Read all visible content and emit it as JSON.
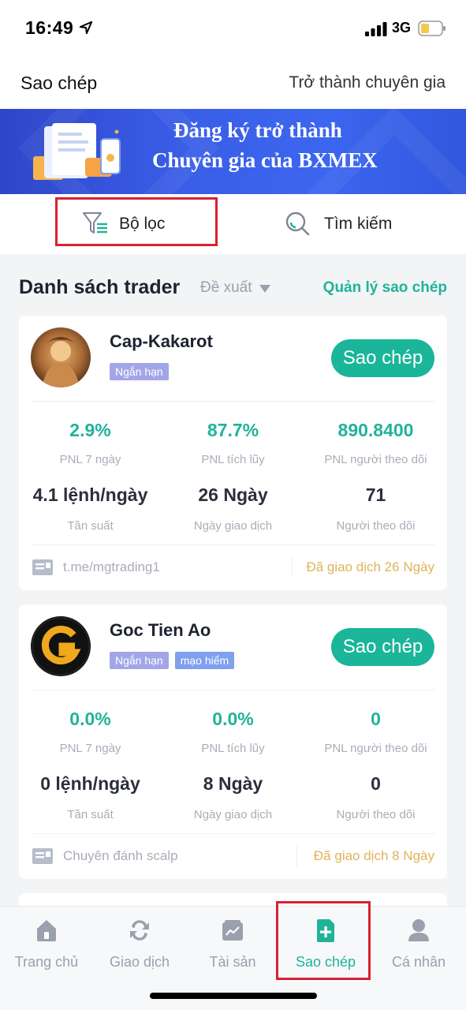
{
  "status_bar": {
    "time": "16:49",
    "network": "3G"
  },
  "header": {
    "title": "Sao chép",
    "action": "Trở thành chuyên gia"
  },
  "banner": {
    "line1": "Đăng ký trở thành",
    "line2": "Chuyên gia của BXMEX"
  },
  "filters": {
    "filter_label": "Bộ lọc",
    "search_label": "Tìm kiếm"
  },
  "section": {
    "title": "Danh sách trader",
    "sort_value": "Đề xuất",
    "manage_link": "Quản lý sao chép"
  },
  "traders": [
    {
      "name": "Cap-Kakarot",
      "tags": [
        "Ngắn hạn"
      ],
      "copy_label": "Sao chép",
      "stats": [
        {
          "value": "2.9%",
          "label": "PNL 7 ngày"
        },
        {
          "value": "87.7%",
          "label": "PNL tích lũy"
        },
        {
          "value": "890.8400",
          "label": "PNL người theo dõi"
        },
        {
          "value": "4.1 lệnh/ngày",
          "label": "Tần suất"
        },
        {
          "value": "26 Ngày",
          "label": "Ngày giao dịch"
        },
        {
          "value": "71",
          "label": "Người theo dõi"
        }
      ],
      "note": "t.me/mgtrading1",
      "days_traded": "Đã giao dịch 26 Ngày"
    },
    {
      "name": "Goc Tien Ao",
      "tags": [
        "Ngắn hạn",
        "mạo hiểm"
      ],
      "copy_label": "Sao chép",
      "stats": [
        {
          "value": "0.0%",
          "label": "PNL 7 ngày"
        },
        {
          "value": "0.0%",
          "label": "PNL tích lũy"
        },
        {
          "value": "0",
          "label": "PNL người theo dõi"
        },
        {
          "value": "0 lệnh/ngày",
          "label": "Tần suất"
        },
        {
          "value": "8 Ngày",
          "label": "Ngày giao dịch"
        },
        {
          "value": "0",
          "label": "Người theo dõi"
        }
      ],
      "note": "Chuyên đánh scalp",
      "days_traded": "Đã giao dịch 8 Ngày"
    }
  ],
  "tabbar": {
    "items": [
      {
        "label": "Trang chủ",
        "icon": "home-icon"
      },
      {
        "label": "Giao dịch",
        "icon": "exchange-icon"
      },
      {
        "label": "Tài sản",
        "icon": "wallet-chart-icon"
      },
      {
        "label": "Sao chép",
        "icon": "copy-add-icon",
        "active": true
      },
      {
        "label": "Cá nhân",
        "icon": "person-icon"
      }
    ]
  },
  "colors": {
    "accent": "#1bb59a",
    "banner": "#3a5ee8",
    "highlight": "#d62232",
    "days": "#e0b35c"
  }
}
